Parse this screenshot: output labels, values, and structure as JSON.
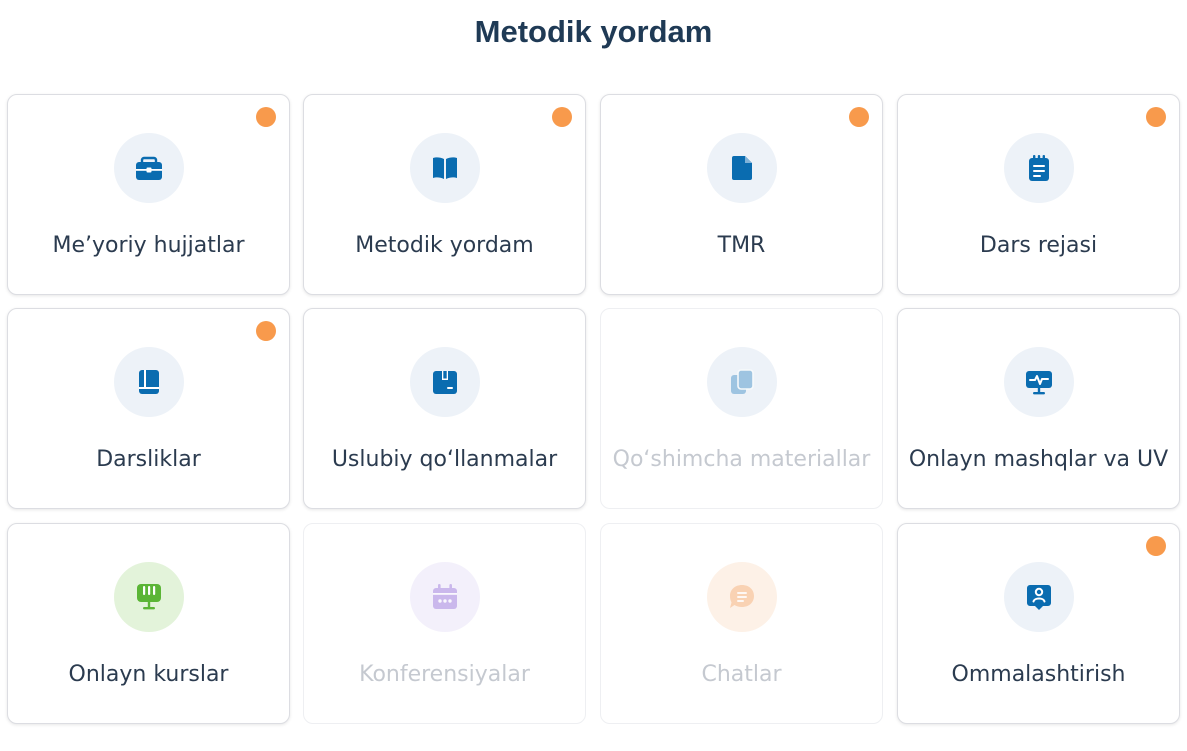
{
  "page": {
    "title": "Metodik yordam"
  },
  "colors": {
    "accent": "#0a6cb0",
    "badge": "#f89a4c",
    "title": "#1f3a55"
  },
  "cards": [
    {
      "label": "Me’yoriy hujjatlar",
      "icon": "briefcase-icon",
      "badge": true,
      "disabled": false
    },
    {
      "label": "Metodik yordam",
      "icon": "open-book-icon",
      "badge": true,
      "disabled": false
    },
    {
      "label": "TMR",
      "icon": "document-icon",
      "badge": true,
      "disabled": false
    },
    {
      "label": "Dars rejasi",
      "icon": "notepad-icon",
      "badge": true,
      "disabled": false
    },
    {
      "label": "Darsliklar",
      "icon": "book-icon",
      "badge": true,
      "disabled": false
    },
    {
      "label": "Uslubiy qo‘llanmalar",
      "icon": "box-icon",
      "badge": false,
      "disabled": false
    },
    {
      "label": "Qo‘shimcha materiallar",
      "icon": "copy-icon",
      "badge": false,
      "disabled": true
    },
    {
      "label": "Onlayn mashqlar va UV",
      "icon": "monitor-pulse-icon",
      "badge": false,
      "disabled": false
    },
    {
      "label": "Onlayn kurslar",
      "icon": "presenter-board-icon",
      "badge": false,
      "disabled": false
    },
    {
      "label": "Konferensiyalar",
      "icon": "calendar-icon",
      "badge": false,
      "disabled": true
    },
    {
      "label": "Chatlar",
      "icon": "chat-icon",
      "badge": false,
      "disabled": true
    },
    {
      "label": "Ommalashtirish",
      "icon": "user-badge-icon",
      "badge": true,
      "disabled": false
    }
  ]
}
